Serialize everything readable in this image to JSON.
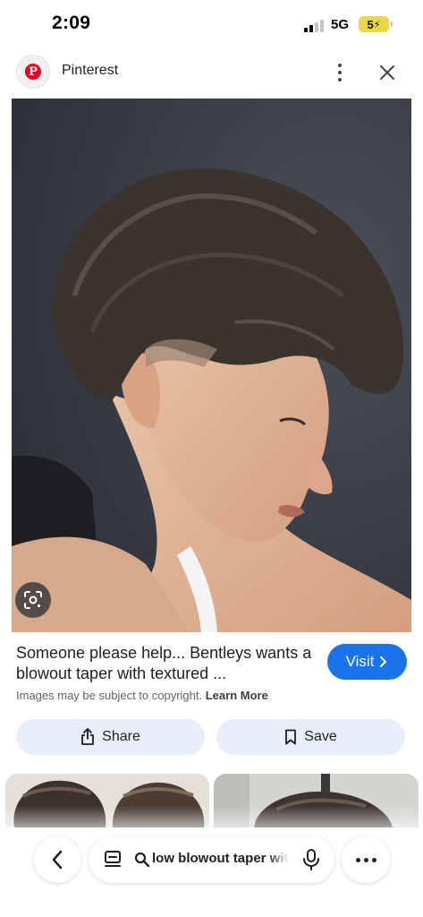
{
  "status_bar": {
    "time": "2:09",
    "network": "5G",
    "battery": "5"
  },
  "header": {
    "source_name": "Pinterest",
    "logo_letter": "P"
  },
  "result": {
    "title": "Someone please help... Bentleys wants a blowout taper with textured ...",
    "visit_label": "Visit",
    "copyright_text": "Images may be subject to copyright.",
    "learn_more": "Learn More"
  },
  "actions": {
    "share_label": "Share",
    "save_label": "Save"
  },
  "toolbar": {
    "query": "low blowout taper with textured"
  },
  "colors": {
    "accent": "#1a73e8",
    "pill_bg": "#e8eefa",
    "pinterest_red": "#e60023",
    "battery": "#e8d84a"
  },
  "icons": [
    "lens-icon",
    "chevron-right-icon",
    "share-icon",
    "bookmark-icon",
    "chevron-left-icon",
    "tabs-icon",
    "search-icon",
    "mic-icon",
    "more-dots-icon",
    "close-icon"
  ]
}
